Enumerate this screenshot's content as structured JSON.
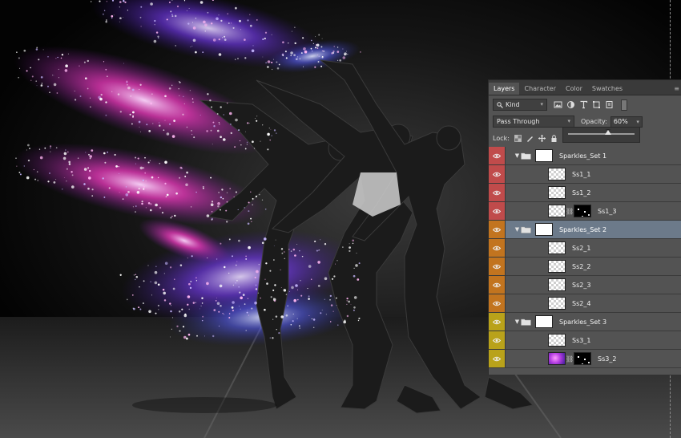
{
  "colors": {
    "panel_bg": "#535353",
    "selected_row": "#6c7a8a",
    "eye_red": "#c04b4b",
    "eye_orange": "#c2741f",
    "eye_yellow": "#b9a21a",
    "sparkle_pink": "#ff3ccd",
    "sparkle_purple": "#8a3cff",
    "sparkle_blue": "#5a62ff"
  },
  "canvas": {
    "description_icon": "dancers-sparkles-artwork"
  },
  "panel": {
    "tabs": [
      {
        "label": "Layers",
        "active": true
      },
      {
        "label": "Character",
        "active": false
      },
      {
        "label": "Color",
        "active": false
      },
      {
        "label": "Swatches",
        "active": false
      }
    ],
    "filter": {
      "kind_label": "Kind",
      "icon": "search-icon"
    },
    "blend_mode": "Pass Through",
    "opacity": {
      "label": "Opacity:",
      "value": "60%",
      "fraction": 0.6
    },
    "lock_label": "Lock:"
  },
  "layers": [
    {
      "name": "Sparkles_Set 1",
      "type": "group",
      "eye": "red",
      "thumb": "white",
      "selected": false
    },
    {
      "name": "Ss1_1",
      "type": "layer",
      "eye": "red",
      "thumb": "checker",
      "selected": false
    },
    {
      "name": "Ss1_2",
      "type": "layer",
      "eye": "red",
      "thumb": "checker",
      "selected": false
    },
    {
      "name": "Ss1_3",
      "type": "masked",
      "eye": "red",
      "thumb": "checker",
      "mask": "black",
      "selected": false
    },
    {
      "name": "Sparkles_Set 2",
      "type": "group",
      "eye": "orange",
      "thumb": "white",
      "selected": true
    },
    {
      "name": "Ss2_1",
      "type": "layer",
      "eye": "orange",
      "thumb": "checker",
      "selected": false
    },
    {
      "name": "Ss2_2",
      "type": "layer",
      "eye": "orange",
      "thumb": "checker",
      "selected": false
    },
    {
      "name": "Ss2_3",
      "type": "layer",
      "eye": "orange",
      "thumb": "checker",
      "selected": false
    },
    {
      "name": "Ss2_4",
      "type": "layer",
      "eye": "orange",
      "thumb": "checker",
      "selected": false
    },
    {
      "name": "Sparkles_Set 3",
      "type": "group",
      "eye": "yellow",
      "thumb": "white",
      "selected": false
    },
    {
      "name": "Ss3_1",
      "type": "layer",
      "eye": "yellow",
      "thumb": "checker",
      "selected": false
    },
    {
      "name": "Ss3_2",
      "type": "masked",
      "eye": "yellow",
      "thumb": "purple",
      "mask": "black",
      "selected": false
    }
  ]
}
